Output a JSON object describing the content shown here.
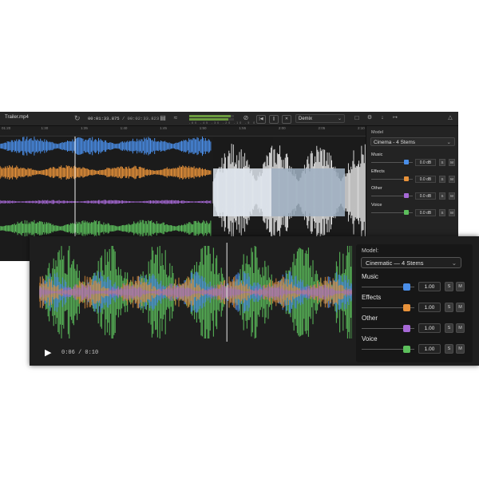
{
  "back_window": {
    "file_name": "Trailer.mp4",
    "timecode_current": "00:01:33.875",
    "timecode_total": "/ 00:02:33.823",
    "meter_ticks": "-60 -45 -30 -20 -10 -5 0",
    "meter_levels": [
      0.92,
      0.88
    ],
    "demix_label": "Demix",
    "ruler_ticks": [
      "01:20",
      "1:30",
      "1:35",
      "1:40",
      "1:45",
      "1:50",
      "1:55",
      "2:00",
      "2:05",
      "2:10"
    ],
    "model_label": "Model",
    "model_value": "Cinema - 4 Stems",
    "stems": [
      {
        "name": "Music",
        "value": "0.0 dB",
        "color": "#4a8ee8",
        "level": 0.85,
        "solo": "S",
        "mute": "M"
      },
      {
        "name": "Effects",
        "value": "0.0 dB",
        "color": "#e8923a",
        "level": 0.85,
        "solo": "S",
        "mute": "M"
      },
      {
        "name": "Other",
        "value": "0.0 dB",
        "color": "#a669d6",
        "level": 0.85,
        "solo": "S",
        "mute": "M"
      },
      {
        "name": "Voice",
        "value": "0.0 dB",
        "color": "#5cbf5c",
        "level": 0.85,
        "solo": "S",
        "mute": "M"
      }
    ]
  },
  "front_window": {
    "model_label": "Model:",
    "model_value": "Cinematic — 4 Stems",
    "playback_time": "0:06 / 0:10",
    "playhead_fraction": 0.6,
    "stems": [
      {
        "name": "Music",
        "value": "1.00",
        "color": "#4a8ee8",
        "level": 0.85,
        "solo": "S",
        "mute": "M"
      },
      {
        "name": "Effects",
        "value": "1.00",
        "color": "#e8923a",
        "level": 0.85,
        "solo": "S",
        "mute": "M"
      },
      {
        "name": "Other",
        "value": "1.00",
        "color": "#a669d6",
        "level": 0.85,
        "solo": "S",
        "mute": "M"
      },
      {
        "name": "Voice",
        "value": "1.00",
        "color": "#5cbf5c",
        "level": 0.85,
        "solo": "S",
        "mute": "M"
      }
    ]
  },
  "icons": [
    "refresh-icon",
    "film-icon",
    "waveform-icon",
    "mute-icon",
    "skip-back-icon",
    "pause-icon",
    "stop-icon",
    "settings-icon",
    "download-icon",
    "export-icon",
    "metronome-icon",
    "play-icon",
    "chevron-down-icon"
  ]
}
